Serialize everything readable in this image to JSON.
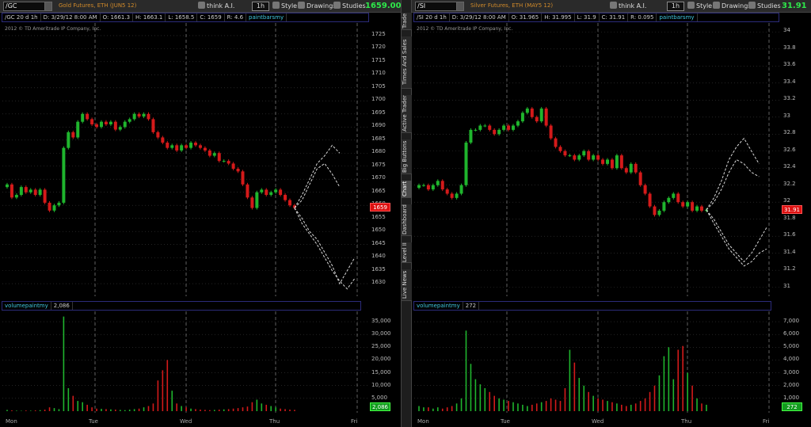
{
  "left": {
    "symbol": "/GC",
    "instrument": "Gold Futures, ETH (JUN5 12)",
    "think_ai": "think A.I.",
    "aggregation": "1h",
    "style": "Style",
    "drawings": "Drawings",
    "studies": "Studies",
    "last": "1659.00",
    "info": {
      "name": "/GC 20 d 1h",
      "date": "D: 3/29/12 8:00 AM",
      "open": "O: 1661.3",
      "high": "H: 1663.1",
      "low": "L: 1658.5",
      "close": "C: 1659",
      "range": "R: 4.6",
      "study": "paintbarsmy"
    },
    "copyright": "2012 © TD Ameritrade IP Company, Inc.",
    "price_ticks": [
      "1725",
      "1720",
      "1715",
      "1710",
      "1705",
      "1700",
      "1695",
      "1690",
      "1685",
      "1680",
      "1675",
      "1670",
      "1665",
      "1660",
      "1655",
      "1650",
      "1645",
      "1640",
      "1635",
      "1630"
    ],
    "price_tag": "1659",
    "vol_study": "volumepaintmy",
    "vol_value": "2,086",
    "vol_ticks": [
      "35,000",
      "30,000",
      "25,000",
      "20,000",
      "15,000",
      "10,000",
      "5,000"
    ],
    "vol_tag": "2,086"
  },
  "right": {
    "symbol": "/SI",
    "instrument": "Silver Futures, ETH (MAY5 12)",
    "think_ai": "think A.I.",
    "aggregation": "1h",
    "style": "Style",
    "drawings": "Drawings",
    "studies": "Studies",
    "last": "31.91",
    "info": {
      "name": "/SI 20 d 1h",
      "date": "D: 3/29/12 8:00 AM",
      "open": "O: 31.965",
      "high": "H: 31.995",
      "low": "L: 31.9",
      "close": "C: 31.91",
      "range": "R: 0.095",
      "study": "paintbarsmy"
    },
    "copyright": "2012 © TD Ameritrade IP Company, Inc.",
    "price_ticks": [
      "34",
      "33.8",
      "33.6",
      "33.4",
      "33.2",
      "33",
      "32.8",
      "32.6",
      "32.4",
      "32.2",
      "32",
      "31.8",
      "31.6",
      "31.4",
      "31.2",
      "31"
    ],
    "price_tag": "31.91",
    "vol_study": "volumepaintmy",
    "vol_value": "272",
    "vol_ticks": [
      "7,000",
      "6,000",
      "5,000",
      "4,000",
      "3,000",
      "2,000",
      "1,000"
    ],
    "vol_tag": "272"
  },
  "days": [
    "Mon",
    "Tue",
    "Wed",
    "Thu",
    "Fri"
  ],
  "side_tabs": [
    "Trade",
    "Times And Sales",
    "Active Trader",
    "Big Buttons",
    "Chart",
    "Dashboard",
    "Level II",
    "Live News"
  ],
  "colors": {
    "up": "#1fb52d",
    "down": "#d41a1a",
    "projection": "#d8d8d8",
    "grid": "#3a3a3a",
    "last_price": "#2ee84a"
  },
  "chart_data": [
    {
      "type": "candlestick",
      "title": "/GC 20 d 1h",
      "ylim": [
        1627,
        1728
      ],
      "closes": [
        1668,
        1663,
        1664,
        1667,
        1665,
        1666,
        1664,
        1666,
        1661,
        1658,
        1660,
        1661,
        1682,
        1688,
        1686,
        1692,
        1695,
        1693,
        1691,
        1690,
        1692,
        1691,
        1692,
        1689,
        1690,
        1692,
        1693,
        1695,
        1694,
        1695,
        1693,
        1688,
        1686,
        1684,
        1682,
        1683,
        1681,
        1683,
        1682,
        1684,
        1683,
        1682,
        1681,
        1679,
        1680,
        1677,
        1677,
        1676,
        1674,
        1673,
        1668,
        1663,
        1659,
        1665,
        1666,
        1664,
        1665,
        1666,
        1664,
        1662,
        1660,
        1659
      ],
      "proj_up_a": [
        1659,
        1664,
        1670,
        1676,
        1679,
        1683,
        1680
      ],
      "proj_up_b": [
        1659,
        1662,
        1668,
        1674,
        1676,
        1672,
        1667
      ],
      "proj_down_a": [
        1659,
        1655,
        1650,
        1647,
        1642,
        1637,
        1630,
        1635,
        1640
      ],
      "proj_down_b": [
        1659,
        1653,
        1649,
        1645,
        1640,
        1635,
        1631,
        1628,
        1632
      ],
      "volume": [
        500,
        300,
        200,
        150,
        250,
        200,
        300,
        400,
        600,
        1500,
        1200,
        800,
        37000,
        9000,
        6000,
        4000,
        3500,
        2500,
        1500,
        1000,
        900,
        800,
        700,
        600,
        500,
        400,
        600,
        800,
        1000,
        1500,
        2000,
        3000,
        12000,
        16000,
        20000,
        8000,
        3000,
        2000,
        1500,
        1000,
        800,
        600,
        500,
        400,
        500,
        600,
        700,
        800,
        1000,
        1200,
        1500,
        1800,
        3500,
        4500,
        3000,
        2500,
        2000,
        1500,
        1000,
        800,
        600,
        500
      ]
    },
    {
      "type": "candlestick",
      "title": "/SI 20 d 1h",
      "ylim": [
        30.95,
        34.05
      ],
      "closes": [
        32.2,
        32.2,
        32.15,
        32.2,
        32.25,
        32.15,
        32.1,
        32.05,
        32.1,
        32.2,
        32.7,
        32.85,
        32.85,
        32.9,
        32.9,
        32.85,
        32.8,
        32.85,
        32.9,
        32.85,
        32.9,
        32.95,
        33.05,
        33.1,
        33,
        32.95,
        33.1,
        32.9,
        32.75,
        32.65,
        32.6,
        32.55,
        32.55,
        32.5,
        32.55,
        32.6,
        32.5,
        32.55,
        32.5,
        32.45,
        32.5,
        32.4,
        32.55,
        32.4,
        32.35,
        32.45,
        32.35,
        32.2,
        32.1,
        31.95,
        31.85,
        31.9,
        32,
        32.05,
        32.1,
        32,
        31.95,
        32,
        31.9,
        31.95,
        31.9,
        31.91
      ],
      "proj_up_a": [
        31.91,
        32.05,
        32.25,
        32.5,
        32.65,
        32.75,
        32.6,
        32.45
      ],
      "proj_up_b": [
        31.91,
        32,
        32.15,
        32.35,
        32.5,
        32.45,
        32.35,
        32.3
      ],
      "proj_down_a": [
        31.91,
        31.8,
        31.65,
        31.5,
        31.4,
        31.3,
        31.4,
        31.55,
        31.7
      ],
      "proj_down_b": [
        31.91,
        31.75,
        31.6,
        31.45,
        31.35,
        31.25,
        31.3,
        31.4,
        31.45
      ],
      "volume": [
        400,
        300,
        300,
        200,
        300,
        200,
        300,
        400,
        600,
        1000,
        6300,
        3700,
        2500,
        2100,
        1800,
        1500,
        1200,
        1000,
        900,
        800,
        700,
        600,
        500,
        400,
        500,
        600,
        700,
        800,
        1000,
        900,
        800,
        1800,
        4800,
        3800,
        2600,
        2000,
        1500,
        1200,
        1000,
        900,
        800,
        700,
        600,
        500,
        400,
        500,
        600,
        800,
        1000,
        1500,
        2000,
        2800,
        4300,
        5000,
        2500,
        4800,
        5100,
        3000,
        2000,
        1000,
        600,
        500
      ]
    }
  ]
}
